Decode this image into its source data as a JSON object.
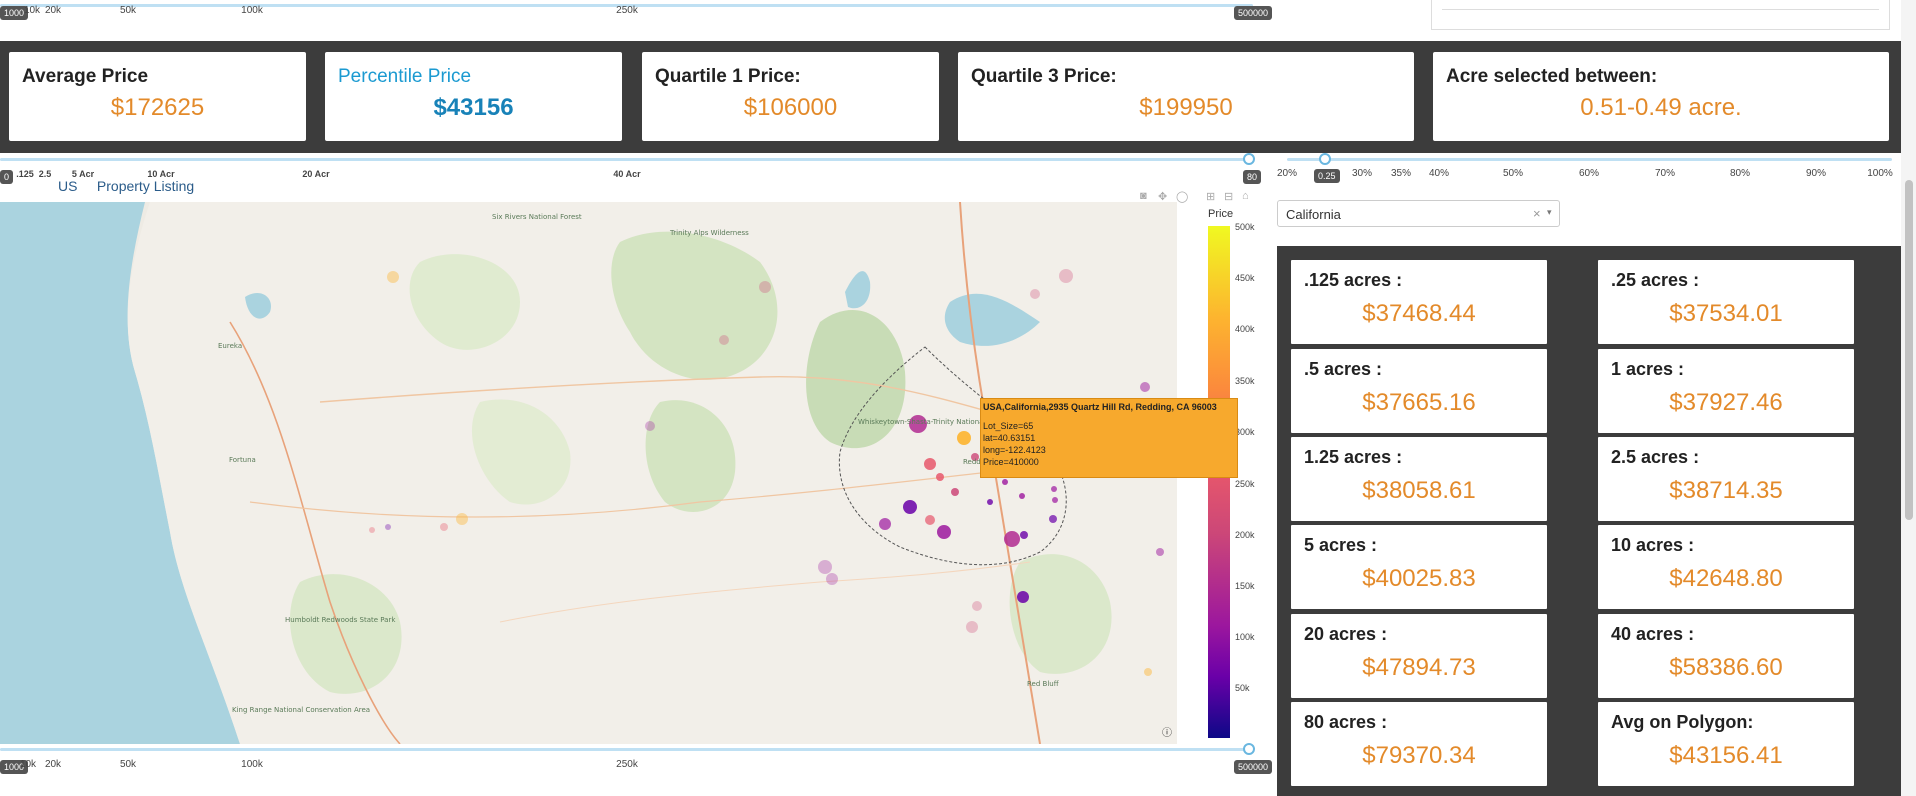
{
  "price_slider_top": {
    "min_box": "1000",
    "max_box": "500000",
    "ticks": [
      "10k",
      "20k",
      "50k",
      "100k",
      "250k"
    ]
  },
  "stats": [
    {
      "title": "Average Price",
      "value": "$172625",
      "highlight": false
    },
    {
      "title": "Percentile Price",
      "value": "$43156",
      "highlight": true
    },
    {
      "title": "Quartile 1 Price:",
      "value": "$106000",
      "highlight": false
    },
    {
      "title": "Quartile 3 Price:",
      "value": "$199950",
      "highlight": false
    },
    {
      "title": "Acre selected between:",
      "value": "0.51-0.49 acre.",
      "highlight": false
    }
  ],
  "acre_slider": {
    "min_box": "0",
    "max_box": "80",
    "ticks": [
      ".125",
      "2.5",
      "5 Acr",
      "10 Acr",
      "20 Acr",
      "40 Acr"
    ]
  },
  "percent_slider": {
    "value_box": "0.25",
    "ticks": [
      "20%",
      "30%",
      "35%",
      "40%",
      "50%",
      "60%",
      "70%",
      "80%",
      "90%",
      "100%"
    ]
  },
  "map": {
    "title_prefix": "US",
    "title": "Property Listing",
    "colorbar_title": "Price",
    "colorbar_ticks": [
      "500k",
      "450k",
      "400k",
      "350k",
      "300k",
      "250k",
      "200k",
      "150k",
      "100k",
      "50k"
    ],
    "places": [
      "Six Rivers National Forest",
      "Trinity Alps Wilderness",
      "Whiskeytown-Shasta-Trinity National Recreation Area",
      "Eureka",
      "Humboldt Redwoods State Park",
      "King Range National Conservation Area",
      "Redding",
      "Red Bluff",
      "Fortuna"
    ]
  },
  "tooltip": {
    "header": "USA,California,2935 Quartz Hill Rd, Redding, CA 96003",
    "lines": [
      "Lot_Size=65",
      "lat=40.63151",
      "long=-122.4123",
      "Price=410000"
    ]
  },
  "price_slider_bottom": {
    "min_box": "1000",
    "max_box": "500000",
    "ticks": [
      "10k",
      "20k",
      "50k",
      "100k",
      "250k"
    ]
  },
  "state_select": {
    "value": "California",
    "clear": "×",
    "arrow": "▾"
  },
  "acre_prices": [
    {
      "label": ".125 acres :",
      "value": "$37468.44"
    },
    {
      "label": ".25 acres :",
      "value": "$37534.01"
    },
    {
      "label": ".5 acres :",
      "value": "$37665.16"
    },
    {
      "label": "1 acres :",
      "value": "$37927.46"
    },
    {
      "label": "1.25 acres :",
      "value": "$38058.61"
    },
    {
      "label": "2.5 acres :",
      "value": "$38714.35"
    },
    {
      "label": "5 acres :",
      "value": "$40025.83"
    },
    {
      "label": "10 acres :",
      "value": "$42648.80"
    },
    {
      "label": "20 acres :",
      "value": "$47894.73"
    },
    {
      "label": "40 acres :",
      "value": "$58386.60"
    },
    {
      "label": "80 acres :",
      "value": "$79370.34"
    },
    {
      "label": "Avg on Polygon:",
      "value": "$43156.41"
    }
  ],
  "colors": {
    "accent_orange": "#e38a2a",
    "accent_blue": "#1b9ad1",
    "panel_dark": "#3c3c3c"
  }
}
